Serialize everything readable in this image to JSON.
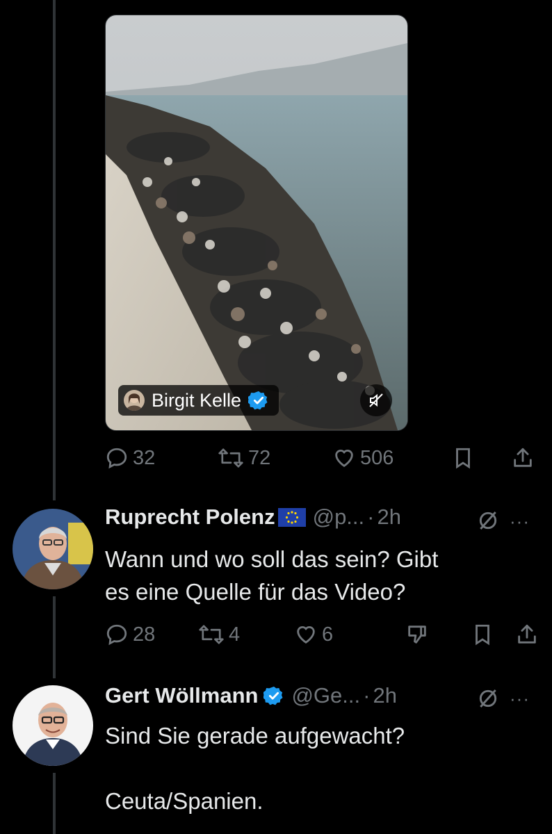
{
  "tweet": {
    "media_author": "Birgit Kelle",
    "stats": {
      "replies": "32",
      "reposts": "72",
      "likes": "506"
    }
  },
  "replies": [
    {
      "name": "Ruprecht Polenz",
      "flag": "eu-flag",
      "handle": "@p...",
      "time": "2h",
      "text": "Wann und wo soll das sein? Gibt\nes eine Quelle für das Video?",
      "stats": {
        "replies": "28",
        "reposts": "4",
        "likes": "6"
      }
    },
    {
      "name": "Gert Wöllmann",
      "verified": true,
      "handle": "@Ge...",
      "time": "2h",
      "text": "Sind Sie gerade aufgewacht?\n\nCeuta/Spanien."
    }
  ],
  "separator": "·",
  "more": "···",
  "colors": {
    "verified": "#1d9bf0",
    "muted_text": "#71767b",
    "line": "#2f3336"
  },
  "icons": [
    "reply-icon",
    "repost-icon",
    "like-icon",
    "bookmark-icon",
    "share-icon",
    "grok-icon",
    "more-icon",
    "mute-icon",
    "dislike-icon"
  ]
}
